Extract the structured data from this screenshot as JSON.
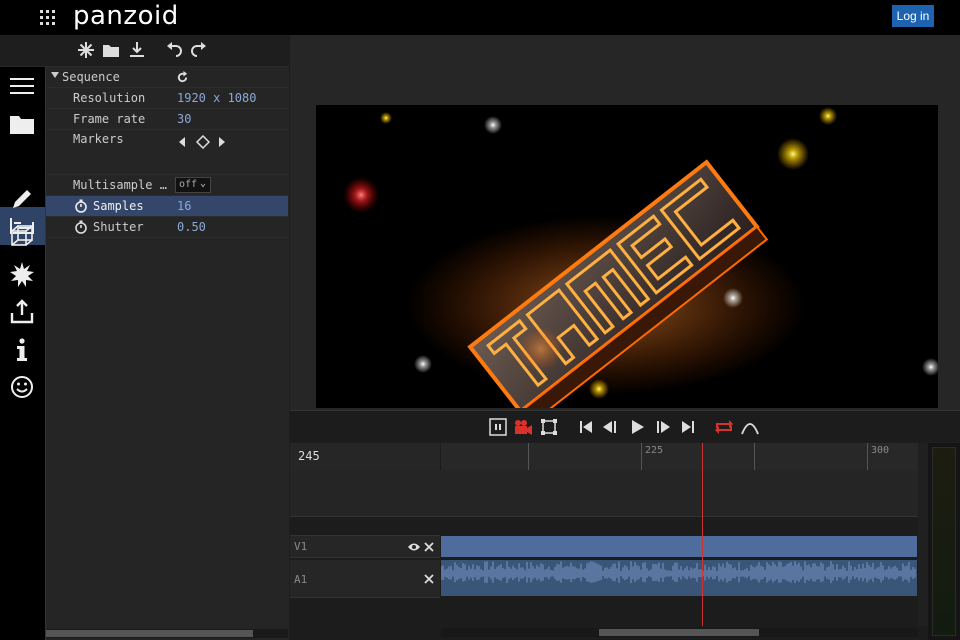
{
  "app": {
    "logo": "panzoid",
    "login_label": "Log in"
  },
  "toolbar": {
    "icons": [
      "new-icon",
      "open-folder-icon",
      "download-icon",
      "undo-icon",
      "redo-icon"
    ]
  },
  "sidebar": {
    "icons": [
      "menu-icon",
      "folder-icon",
      "sequence-icon",
      "pencil-icon",
      "cube-icon",
      "effects-icon",
      "export-icon",
      "info-icon",
      "smiley-icon"
    ],
    "active": "sequence-icon"
  },
  "properties": {
    "section_title": "Sequence",
    "resolution": {
      "label": "Resolution",
      "value": "1920 x 1080"
    },
    "frame_rate": {
      "label": "Frame rate",
      "value": "30"
    },
    "markers": {
      "label": "Markers"
    },
    "multisample": {
      "label": "Multisample …",
      "value": "off"
    },
    "samples": {
      "label": "Samples",
      "value": "16"
    },
    "shutter": {
      "label": "Shutter",
      "value": "0.50"
    }
  },
  "transport": {
    "icons": [
      "pause-icon",
      "record-camera-icon",
      "fit-frame-icon",
      "skip-start-icon",
      "step-back-icon",
      "play-icon",
      "step-forward-icon",
      "skip-end-icon",
      "loop-icon",
      "curve-icon"
    ],
    "accent": "#d9322b"
  },
  "timeline": {
    "current_frame": "245",
    "ruler_labels": [
      "225",
      "300"
    ],
    "tracks": [
      {
        "name": "V1",
        "type": "video"
      },
      {
        "name": "A1",
        "type": "audio"
      }
    ],
    "clip_color": "#4f6d9c"
  }
}
